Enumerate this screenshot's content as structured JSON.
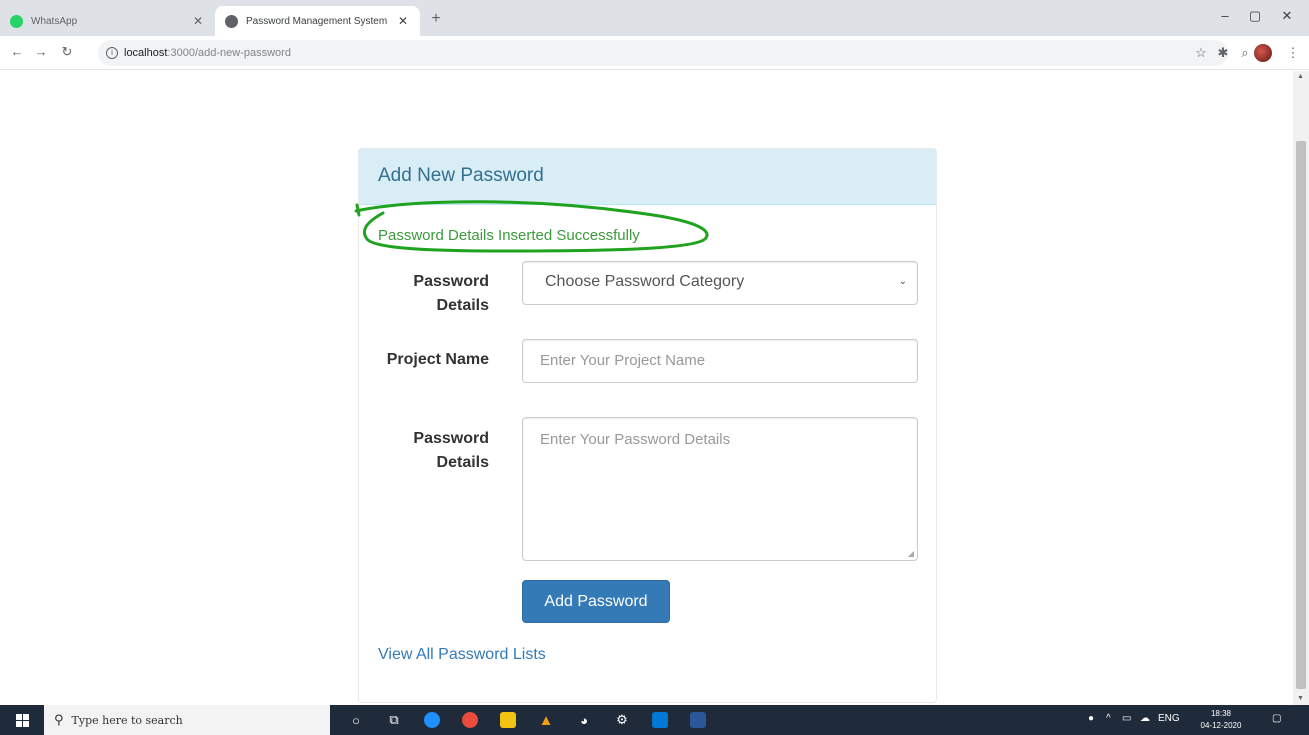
{
  "browser": {
    "tabs": [
      {
        "title": "WhatsApp",
        "favicon_color": "#25d366",
        "active": false
      },
      {
        "title": "Password Management System",
        "favicon_color": "#5f6368",
        "active": true
      }
    ],
    "url_host": "localhost",
    "url_path": ":3000/add-new-password"
  },
  "page": {
    "panel_title": "Add New Password",
    "success_message": "Password Details Inserted Successfully",
    "category_label": "Password Details",
    "category_select_value": "Choose Password Category",
    "project_label": "Project Name",
    "project_placeholder": "Enter Your Project Name",
    "details_label": "Password Details",
    "details_placeholder": "Enter Your Password Details",
    "submit_label": "Add Password",
    "view_link": "View All Password Lists"
  },
  "taskbar": {
    "search_placeholder": "Type here to search",
    "time": "18:38",
    "date": "04-12-2020",
    "lang": "ENG"
  },
  "colors": {
    "heading_bg": "#d9edf7",
    "heading_text": "#31708f",
    "success_text": "#3c9a3c",
    "annotation_circle": "#1fa31f",
    "primary_button": "#337ab7"
  }
}
